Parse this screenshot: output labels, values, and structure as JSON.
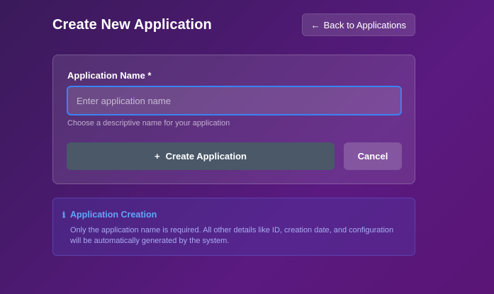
{
  "header": {
    "title": "Create New Application",
    "back_arrow": "←",
    "back_label": "Back to Applications"
  },
  "form": {
    "name_label": "Application Name *",
    "name_value": "",
    "name_placeholder": "Enter application name",
    "name_help": "Choose a descriptive name for your application",
    "create_icon": "+",
    "create_label": "Create Application",
    "cancel_label": "Cancel"
  },
  "info": {
    "icon": "ℹ",
    "title": "Application Creation",
    "text": "Only the application name is required. All other details like ID, creation date, and configuration will be automatically generated by the system."
  },
  "colors": {
    "accent": "#3b82f6",
    "info_text": "#60a5fa",
    "create_button_bg": "#4a5868"
  },
  "icons": {
    "back": "arrow-left-icon",
    "create": "plus-icon",
    "info": "info-icon"
  }
}
